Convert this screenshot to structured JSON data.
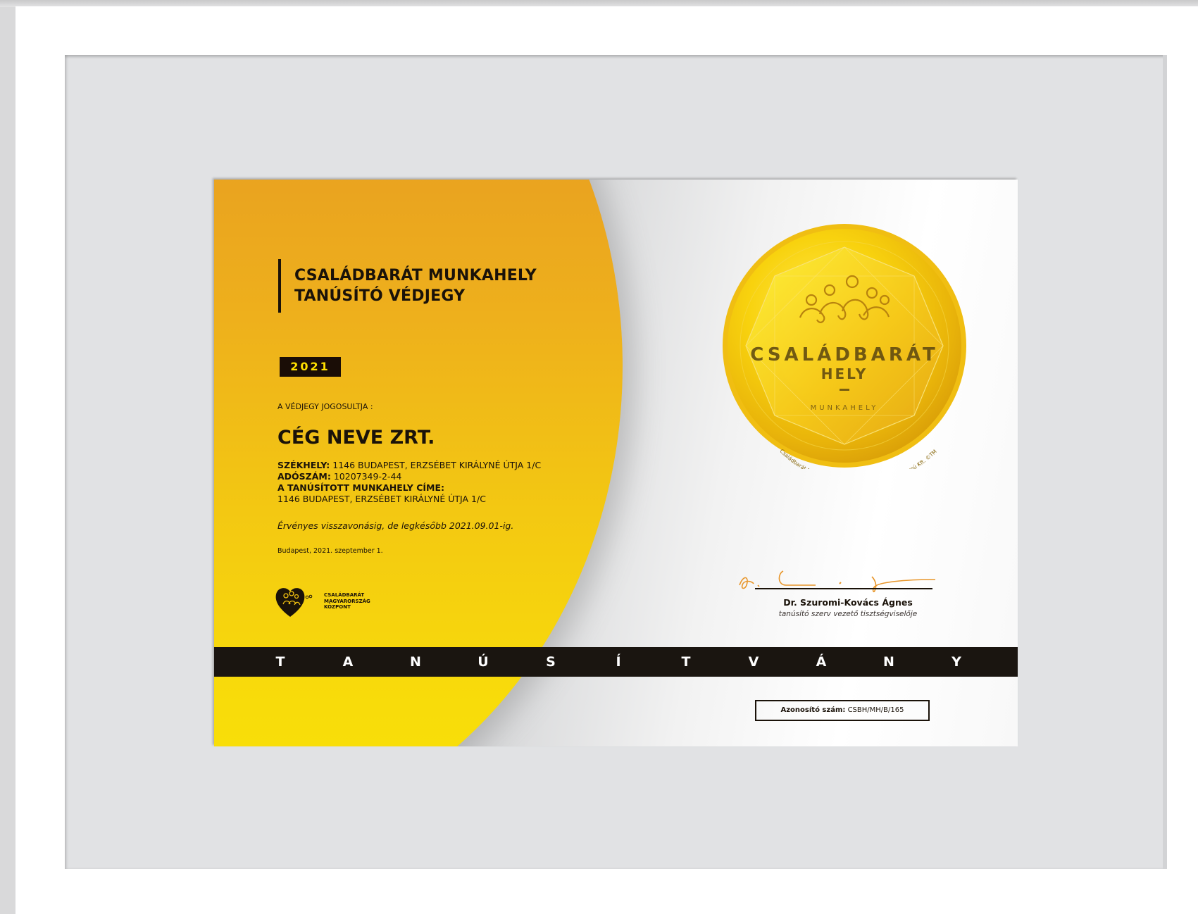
{
  "certificate": {
    "title_line1": "CSALÁDBARÁT MUNKAHELY",
    "title_line2": "TANÚSÍTÓ VÉDJEGY",
    "year": "2021",
    "owner_label": "A VÉDJEGY JOGOSULTJA :",
    "company_name": "CÉG NEVE ZRT.",
    "seat_label": "SZÉKHELY:",
    "seat_value": "1146 BUDAPEST, ERZSÉBET KIRÁLYNÉ ÚTJA 1/C",
    "tax_label": "ADÓSZÁM:",
    "tax_value": "10207349-2-44",
    "workplace_label": "A TANÚSÍTOTT MUNKAHELY CÍME:",
    "workplace_value": "1146 BUDAPEST, ERZSÉBET KIRÁLYNÉ ÚTJA 1/C",
    "validity": "Érvényes visszavonásig, de legkésőbb 2021.09.01-ig.",
    "place_date": "Budapest, 2021. szeptember 1.",
    "org_name_lines": [
      "CSALÁDBARÁT",
      "MAGYARORSZÁG",
      "KÖZPONT"
    ],
    "signer_name": "Dr. Szuromi-Kovács Ágnes",
    "signer_role": "tanúsító szerv vezető tisztségviselője",
    "band_letters": [
      "T",
      "A",
      "N",
      "Ú",
      "S",
      "Í",
      "T",
      "V",
      "Á",
      "N",
      "Y"
    ],
    "id_label": "Azonosító szám:",
    "id_value": "CSBH/MH/B/165"
  },
  "seal": {
    "line1": "CSALÁDBARÁT",
    "line2": "HELY",
    "line3": "MUNKAHELY",
    "ring_text": "Családbarát Magyarország Központ Nonprofit Közhasznú Kft. ©TM"
  },
  "colors": {
    "gold_top": "#e69a22",
    "gold_bottom": "#fae206",
    "dark": "#1a1209",
    "year_text": "#ffe000",
    "signature_ink": "#e8962a"
  }
}
